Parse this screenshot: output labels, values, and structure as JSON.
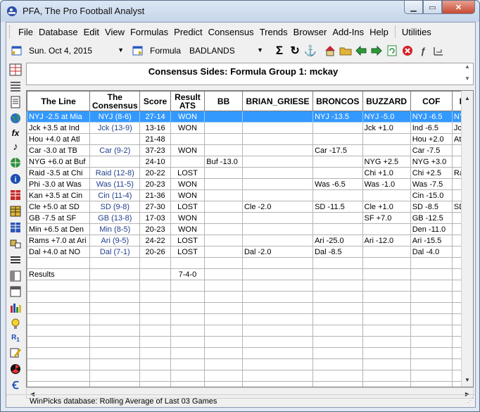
{
  "window": {
    "title": "PFA,  The Pro Football Analyst"
  },
  "menu": [
    "File",
    "Database",
    "Edit",
    "View",
    "Formulas",
    "Predict",
    "Consensus",
    "Trends",
    "Browser",
    "Add-Ins",
    "Help",
    "Utilities"
  ],
  "toolbar": {
    "date_value": "Sun. Oct  4, 2015",
    "formula_label": "Formula",
    "formula_value": "BADLANDS"
  },
  "panel": {
    "title": "Consensus Sides: Formula Group 1: mckay"
  },
  "grid": {
    "headers": [
      "The Line",
      "The Consensus",
      "Score",
      "Result ATS",
      "BB",
      "BRIAN_GRIESE",
      "BRONCOS",
      "BUZZARD",
      "COF",
      "D"
    ],
    "rows": [
      [
        "NYJ -2.5 at Mia",
        "NYJ (8-6)",
        "27-14",
        "WON",
        "",
        "",
        "NYJ -13.5",
        "NYJ -5.0",
        "NYJ -6.5",
        "NYJ"
      ],
      [
        "Jck +3.5 at Ind",
        "Jck (13-9)",
        "13-16",
        "WON",
        "",
        "",
        "",
        "Jck +1.0",
        "Ind -6.5",
        "Jck"
      ],
      [
        "Hou +4.0 at Atl",
        "",
        "21-48",
        "",
        "",
        "",
        "",
        "",
        "Hou +2.0",
        "Atl"
      ],
      [
        "Car -3.0 at TB",
        "Car (9-2)",
        "37-23",
        "WON",
        "",
        "",
        "Car -17.5",
        "",
        "Car -7.5",
        ""
      ],
      [
        "NYG +6.0 at Buf",
        "",
        "24-10",
        "",
        "Buf -13.0",
        "",
        "",
        "NYG +2.5",
        "NYG +3.0",
        ""
      ],
      [
        "Raid -3.5 at Chi",
        "Raid (12-8)",
        "20-22",
        "LOST",
        "",
        "",
        "",
        "Chi +1.0",
        "Chi +2.5",
        "Ra"
      ],
      [
        "Phi -3.0 at Was",
        "Was (11-5)",
        "20-23",
        "WON",
        "",
        "",
        "Was -6.5",
        "Was -1.0",
        "Was -7.5",
        ""
      ],
      [
        "Kan +3.5 at Cin",
        "Cin (11-4)",
        "21-36",
        "WON",
        "",
        "",
        "",
        "",
        "Cin -15.0",
        ""
      ],
      [
        "Cle +5.0 at SD",
        "SD (9-8)",
        "27-30",
        "LOST",
        "",
        "Cle -2.0",
        "SD -11.5",
        "Cle +1.0",
        "SD -8.5",
        "SD"
      ],
      [
        "GB -7.5 at SF",
        "GB (13-8)",
        "17-03",
        "WON",
        "",
        "",
        "",
        "SF +7.0",
        "GB -12.5",
        ""
      ],
      [
        "Min +6.5 at Den",
        "Min (8-5)",
        "20-23",
        "WON",
        "",
        "",
        "",
        "",
        "Den -11.0",
        ""
      ],
      [
        "Rams +7.0 at Ari",
        "Ari (9-5)",
        "24-22",
        "LOST",
        "",
        "",
        "Ari -25.0",
        "Ari -12.0",
        "Ari -15.5",
        ""
      ],
      [
        "Dal +4.0 at NO",
        "Dal (7-1)",
        "20-26",
        "LOST",
        "",
        "Dal -2.0",
        "Dal -8.5",
        "",
        "Dal -4.0",
        ""
      ],
      [
        "",
        "",
        "",
        "",
        "",
        "",
        "",
        "",
        "",
        ""
      ],
      [
        "Results",
        "",
        "",
        "7-4-0",
        "",
        "",
        "",
        "",
        "",
        ""
      ]
    ],
    "empty_rows": 10
  },
  "status": {
    "text": "WinPicks database:  Rolling Average of Last 03 Games"
  }
}
